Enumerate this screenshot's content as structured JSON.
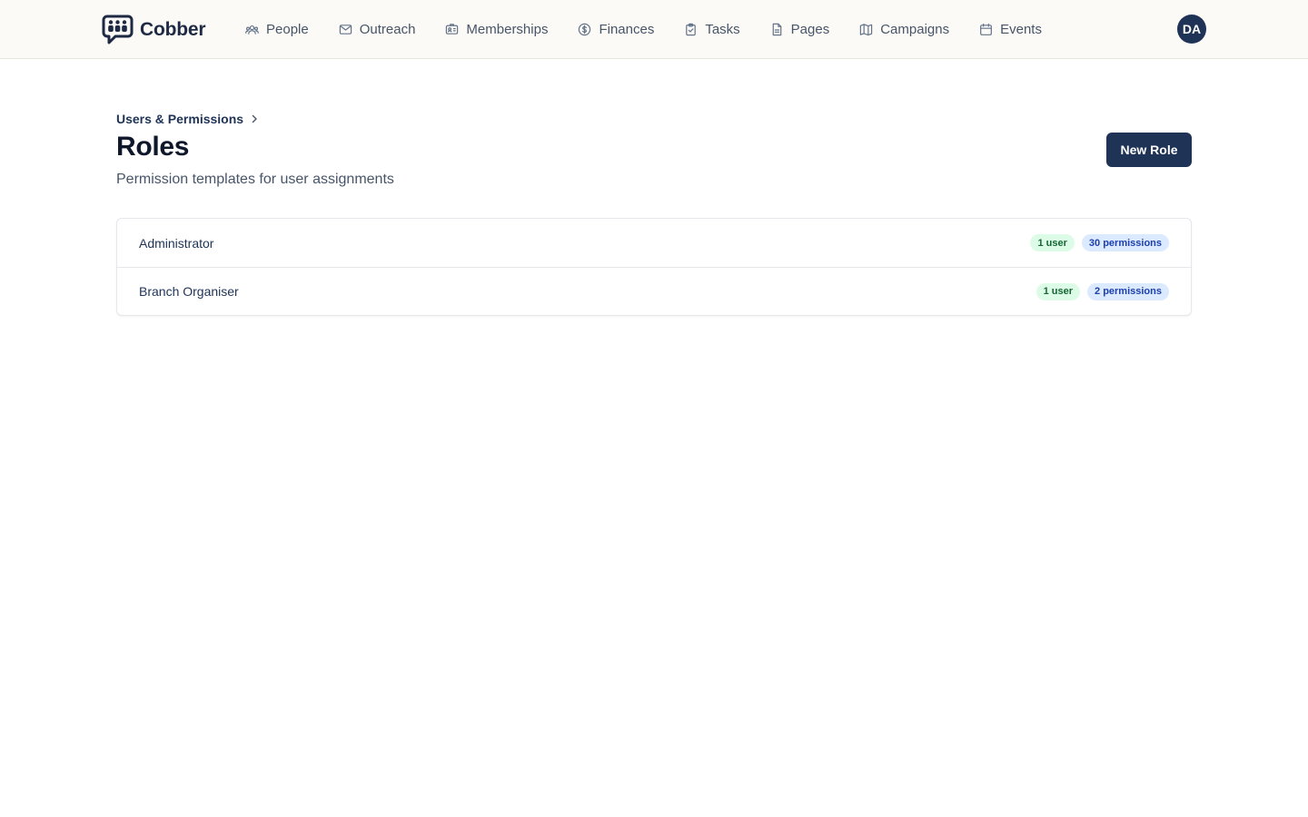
{
  "app": {
    "brand_name": "Cobber",
    "user_initials": "DA"
  },
  "nav": {
    "items": [
      {
        "label": "People",
        "icon": "people-icon"
      },
      {
        "label": "Outreach",
        "icon": "mail-icon"
      },
      {
        "label": "Memberships",
        "icon": "id-card-icon"
      },
      {
        "label": "Finances",
        "icon": "dollar-circle-icon"
      },
      {
        "label": "Tasks",
        "icon": "clipboard-check-icon"
      },
      {
        "label": "Pages",
        "icon": "document-icon"
      },
      {
        "label": "Campaigns",
        "icon": "map-icon"
      },
      {
        "label": "Events",
        "icon": "calendar-icon"
      }
    ]
  },
  "breadcrumb": {
    "parent": "Users & Permissions"
  },
  "page": {
    "title": "Roles",
    "subtitle": "Permission templates for user assignments",
    "new_role_label": "New Role"
  },
  "roles": [
    {
      "name": "Administrator",
      "users": "1 user",
      "permissions": "30 permissions"
    },
    {
      "name": "Branch Organiser",
      "users": "1 user",
      "permissions": "2 permissions"
    }
  ],
  "colors": {
    "primary": "#1e3356",
    "topbar_bg": "#fbfaf6",
    "users_badge_bg": "#dcfce7",
    "users_badge_text": "#166534",
    "permissions_badge_bg": "#dbeafe",
    "permissions_badge_text": "#1e40af"
  }
}
